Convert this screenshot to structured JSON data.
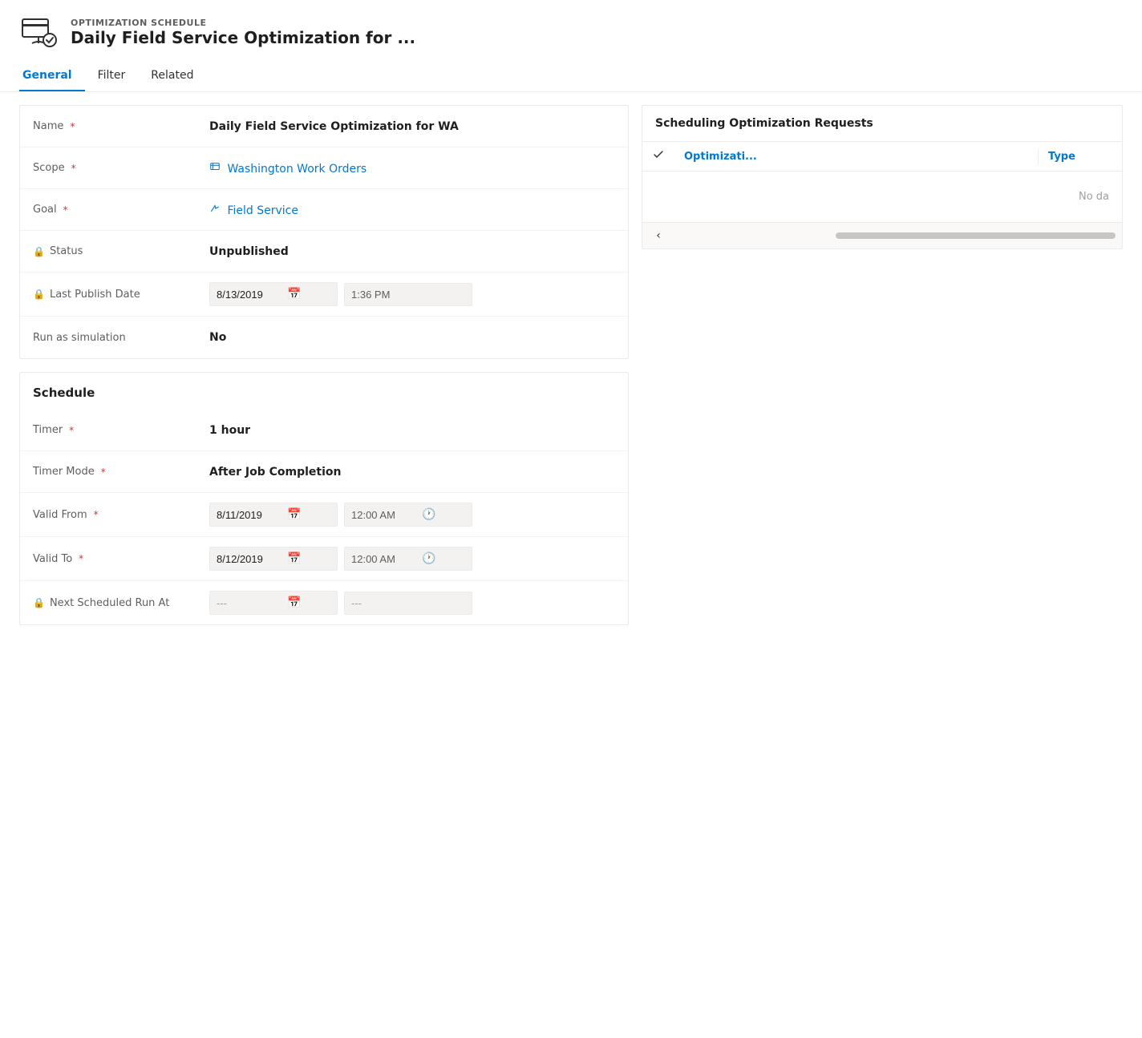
{
  "header": {
    "subtitle": "OPTIMIZATION SCHEDULE",
    "title": "Daily Field Service Optimization for ..."
  },
  "tabs": [
    {
      "id": "general",
      "label": "General",
      "active": true
    },
    {
      "id": "filter",
      "label": "Filter",
      "active": false
    },
    {
      "id": "related",
      "label": "Related",
      "active": false
    }
  ],
  "general_form": {
    "name_label": "Name",
    "name_value": "Daily Field Service Optimization for WA",
    "scope_label": "Scope",
    "scope_value": "Washington Work Orders",
    "goal_label": "Goal",
    "goal_value": "Field Service",
    "status_label": "Status",
    "status_value": "Unpublished",
    "last_publish_label": "Last Publish Date",
    "last_publish_date": "8/13/2019",
    "last_publish_time": "1:36 PM",
    "run_simulation_label": "Run as simulation",
    "run_simulation_value": "No"
  },
  "schedule_form": {
    "section_title": "Schedule",
    "timer_label": "Timer",
    "timer_value": "1 hour",
    "timer_mode_label": "Timer Mode",
    "timer_mode_value": "After Job Completion",
    "valid_from_label": "Valid From",
    "valid_from_date": "8/11/2019",
    "valid_from_time": "12:00 AM",
    "valid_to_label": "Valid To",
    "valid_to_date": "8/12/2019",
    "valid_to_time": "12:00 AM",
    "next_scheduled_label": "Next Scheduled Run At",
    "next_scheduled_date": "---",
    "next_scheduled_time": "---"
  },
  "right_panel": {
    "title": "Scheduling Optimization Requests",
    "col_optimization": "Optimizati...",
    "col_type": "Type",
    "no_data_text": "No da"
  }
}
